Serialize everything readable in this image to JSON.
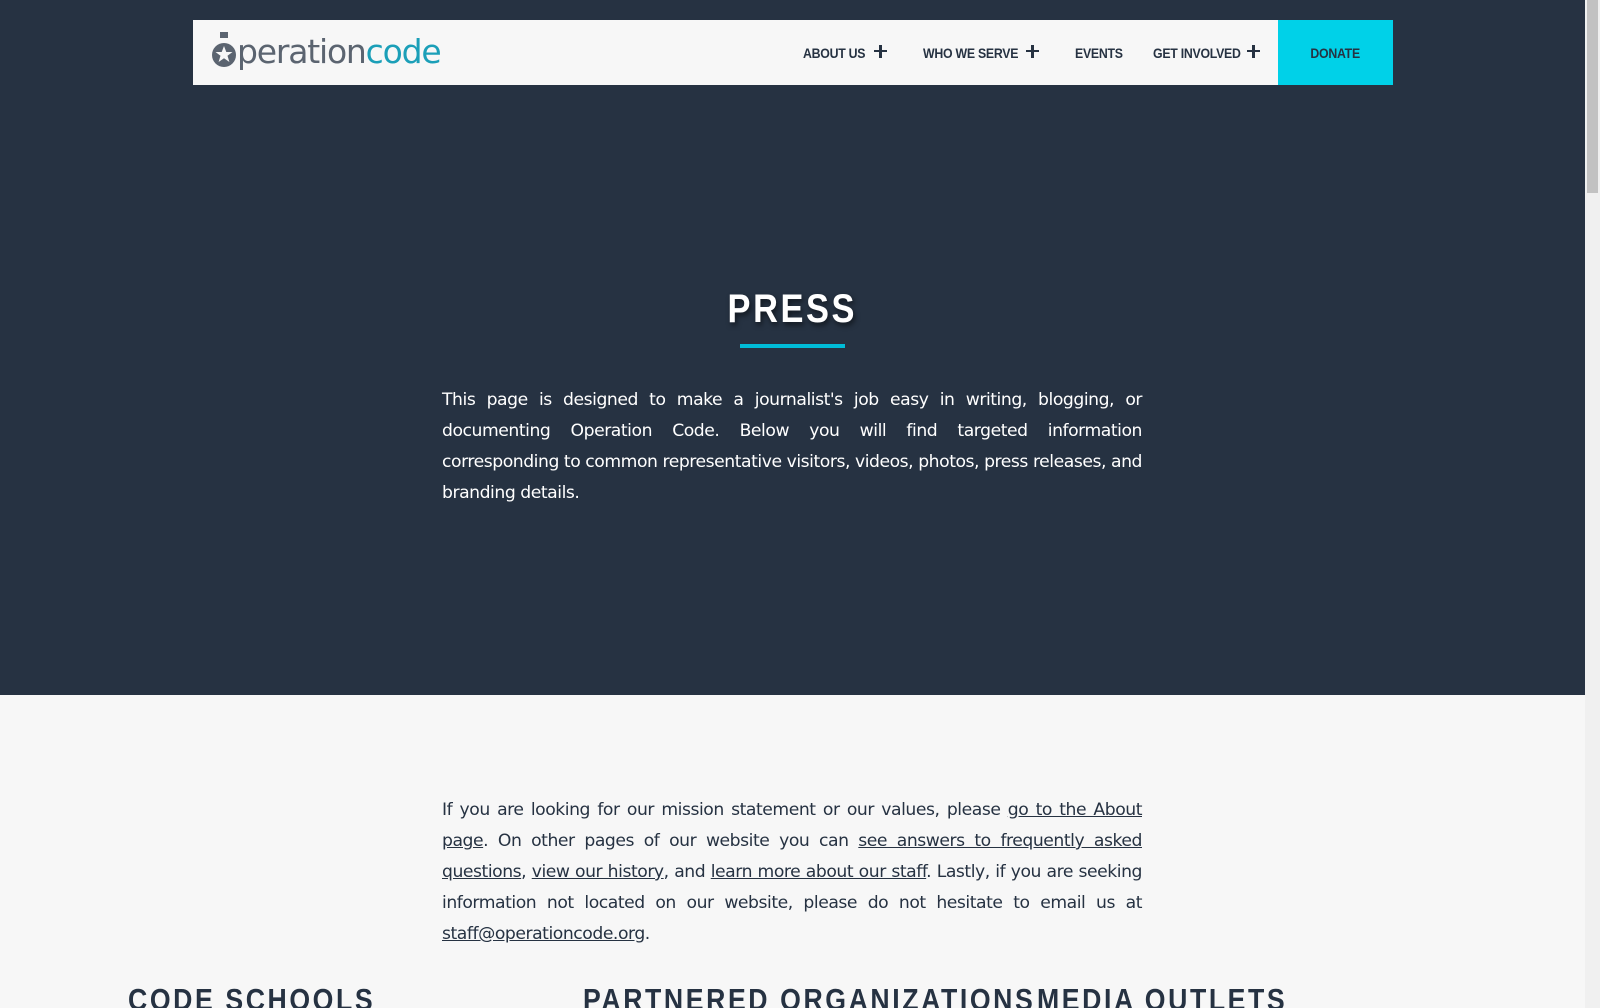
{
  "brand": {
    "logo_part1": "peration",
    "logo_part2": "code"
  },
  "nav": {
    "items": [
      {
        "label": "ABOUT US",
        "has_submenu": true
      },
      {
        "label": "WHO WE SERVE",
        "has_submenu": true
      },
      {
        "label": "EVENTS",
        "has_submenu": false
      },
      {
        "label": "GET INVOLVED",
        "has_submenu": true
      }
    ],
    "donate_label": "DONATE"
  },
  "hero": {
    "title": "PRESS",
    "intro": "This page is designed to make a journalist's job easy in writing, blogging, or documenting Operation Code. Below you will find targeted information corresponding to common representative visitors, videos, photos, press releases, and branding details."
  },
  "content": {
    "p1": "If you are looking for our mission statement or our values, please ",
    "link_about": "go to the About page",
    "p2": ". On other pages of our website you can ",
    "link_faq": "see answers to frequently asked questions",
    "p3": ", ",
    "link_history": "view our history",
    "p4": ", and ",
    "link_staff": "learn more about our staff",
    "p5": ". Lastly, if you are seeking information not located on our website, please do not hesitate to email us at ",
    "link_email": "staff@operationcode.org",
    "p6": "."
  },
  "columns": {
    "code_schools": "CODE SCHOOLS",
    "partnered_orgs": "PARTNERED ORGANIZATIONS",
    "media_outlets": "MEDIA OUTLETS"
  },
  "colors": {
    "navy": "#263242",
    "accent": "#00d1e8",
    "logo_teal": "#1b9fb8",
    "logo_gray": "#5b6470",
    "light_bg": "#f7f7f7"
  }
}
